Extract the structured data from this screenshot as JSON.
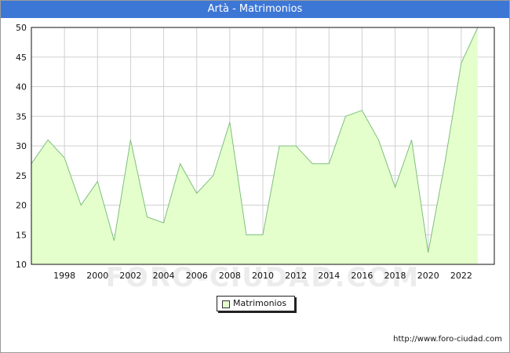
{
  "header": {
    "title": "Artà - Matrimonios"
  },
  "source": "http://www.foro-ciudad.com",
  "watermark": "FORO-CIUDAD.COM",
  "colors": {
    "title_bg": "#3d77d6",
    "fill": "#e4ffcc",
    "line": "#7dbf7d",
    "grid": "#d0d0d0"
  },
  "chart_data": {
    "type": "area",
    "title": "Artà - Matrimonios",
    "xlabel": "",
    "ylabel": "",
    "x": [
      1996,
      1997,
      1998,
      1999,
      2000,
      2001,
      2002,
      2003,
      2004,
      2005,
      2006,
      2007,
      2008,
      2009,
      2010,
      2011,
      2012,
      2013,
      2014,
      2015,
      2016,
      2017,
      2018,
      2019,
      2020,
      2021,
      2022,
      2023
    ],
    "series": [
      {
        "name": "Matrimonios",
        "values": [
          27,
          31,
          28,
          20,
          24,
          14,
          31,
          18,
          17,
          27,
          22,
          25,
          34,
          15,
          15,
          30,
          30,
          27,
          27,
          35,
          36,
          31,
          23,
          31,
          12,
          27,
          44,
          50
        ]
      }
    ],
    "xlim": [
      1996,
      2024
    ],
    "ylim": [
      10,
      50
    ],
    "xticks": [
      1998,
      2000,
      2002,
      2004,
      2006,
      2008,
      2010,
      2012,
      2014,
      2016,
      2018,
      2020,
      2022
    ],
    "yticks": [
      10,
      15,
      20,
      25,
      30,
      35,
      40,
      45,
      50
    ],
    "grid": true,
    "legend_position": "bottom-center"
  }
}
